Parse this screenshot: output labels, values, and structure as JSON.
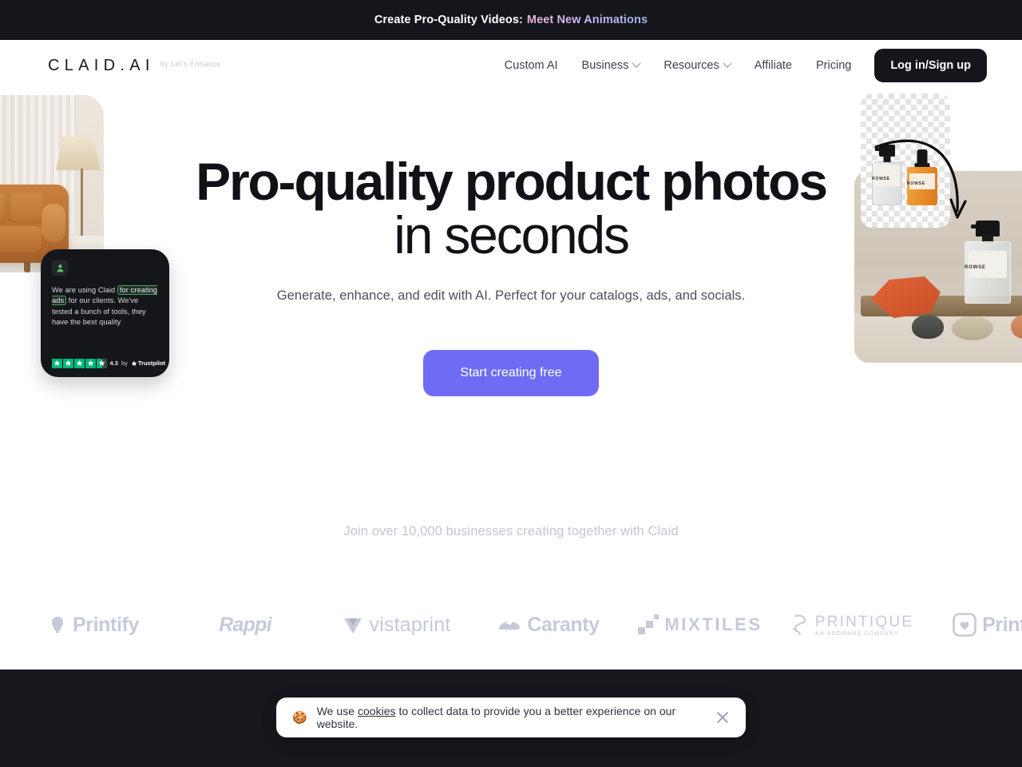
{
  "announcement": {
    "lead_text": "Create Pro-Quality Videos:",
    "link_text": "Meet New Animations"
  },
  "header": {
    "brand_name": "CLAID.AI",
    "brand_sub": "by Let's Enhance",
    "nav": [
      {
        "label": "Custom AI",
        "has_chevron": false
      },
      {
        "label": "Business",
        "has_chevron": true
      },
      {
        "label": "Resources",
        "has_chevron": true
      },
      {
        "label": "Affiliate",
        "has_chevron": false
      },
      {
        "label": "Pricing",
        "has_chevron": false
      }
    ],
    "login_label": "Log in/Sign up"
  },
  "hero": {
    "headline_line1": "Pro-quality product photos",
    "headline_line2": "in seconds",
    "subhead": "Generate, enhance, and edit with AI. Perfect for your catalogs, ads, and socials.",
    "cta_label": "Start creating free",
    "cta_color": "#6f6bf5"
  },
  "testimonial": {
    "text_before": "We are using Claid ",
    "text_highlight": "for creating ads",
    "text_after": " for our clients. We've tested a bunch of tools, they have the best quality",
    "score": "4.3",
    "by_label": "by",
    "platform": "Trustpilot",
    "star_color": "#00b67a",
    "stars_full": 4,
    "stars_half": 1
  },
  "product_images": {
    "before_brand": "ROWSE",
    "after_brand": "ROWSE"
  },
  "social_proof": {
    "text": "Join over 10,000 businesses creating together with Claid",
    "logos": [
      {
        "name": "Printify",
        "sub": ""
      },
      {
        "name": "Rappi",
        "sub": ""
      },
      {
        "name": "vistaprint",
        "sub": ""
      },
      {
        "name": "Caranty",
        "sub": ""
      },
      {
        "name": "MIXTILES",
        "sub": ""
      },
      {
        "name": "PRINTIQUE",
        "sub": "AN ADORAMA COMPANY"
      },
      {
        "name": "Printiful",
        "sub": ""
      }
    ]
  },
  "cookie_banner": {
    "emoji": "cookie-icon",
    "text_before": "We use ",
    "link_text": "cookies",
    "text_after": " to collect data to provide you a better experience on our website."
  }
}
